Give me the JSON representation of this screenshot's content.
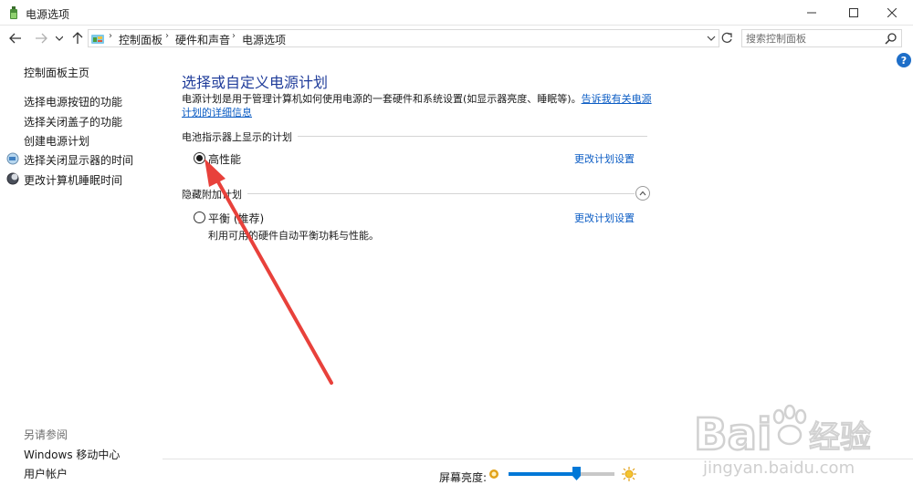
{
  "window": {
    "title": "电源选项"
  },
  "address_bar": {
    "breadcrumbs": [
      "控制面板",
      "硬件和声音",
      "电源选项"
    ],
    "separator": "›"
  },
  "search": {
    "placeholder": "搜索控制面板"
  },
  "help": {
    "label": "?"
  },
  "left_pane": {
    "home": "控制面板主页",
    "links": [
      "选择电源按钮的功能",
      "选择关闭盖子的功能",
      "创建电源计划",
      "选择关闭显示器的时间",
      "更改计算机睡眠时间"
    ],
    "see_also_title": "另请参阅",
    "see_also": [
      "Windows 移动中心",
      "用户帐户"
    ]
  },
  "main": {
    "title": "选择或自定义电源计划",
    "description": "电源计划是用于管理计算机如何使用电源的一套硬件和系统设置(如显示器亮度、睡眠等)。",
    "description_link": "告诉我有关电源计划的详细信息",
    "battery_section_label": "电池指示器上显示的计划",
    "hidden_section_label": "隐藏附加计划",
    "plans": [
      {
        "name": "高性能",
        "selected": true,
        "change_link": "更改计划设置",
        "description": ""
      },
      {
        "name": "平衡 (推荐)",
        "selected": false,
        "change_link": "更改计划设置",
        "description": "利用可用的硬件自动平衡功耗与性能。"
      }
    ]
  },
  "brightness": {
    "label": "屏幕亮度:",
    "level_percent": 64,
    "accent_color": "#0078d7"
  },
  "annotation": {
    "arrow_color": "#e8413b"
  },
  "watermark": {
    "brand": "Bai",
    "brand_suffix": "经验",
    "url": "jingyan.baidu.com"
  }
}
